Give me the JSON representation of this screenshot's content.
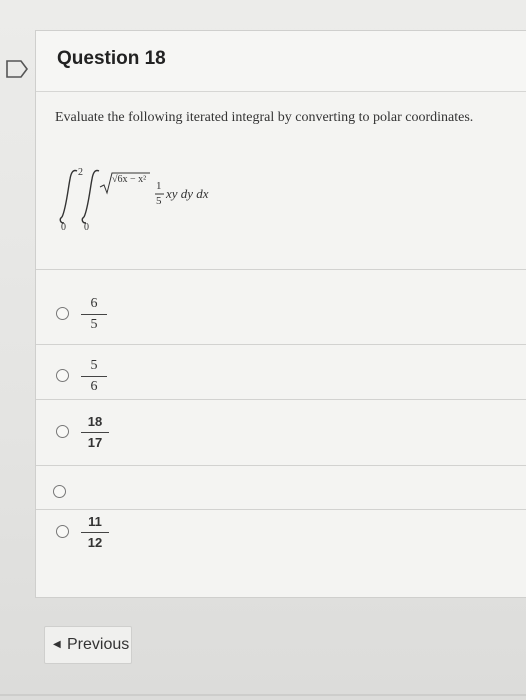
{
  "question": {
    "title": "Question 18",
    "prompt": "Evaluate the following iterated integral by converting to polar coordinates.",
    "integral": {
      "outer_upper": "2",
      "outer_lower": "0",
      "inner_upper": "√6x − x²",
      "inner_lower": "0",
      "coef_num": "1",
      "coef_den": "5",
      "integrand": "xy dy dx"
    }
  },
  "options": [
    {
      "num": "6",
      "den": "5"
    },
    {
      "num": "5",
      "den": "6"
    },
    {
      "num": "18",
      "den": "17"
    },
    {
      "num": "",
      "den": ""
    },
    {
      "num": "11",
      "den": "12"
    }
  ],
  "nav": {
    "previous_label": "Previous"
  }
}
